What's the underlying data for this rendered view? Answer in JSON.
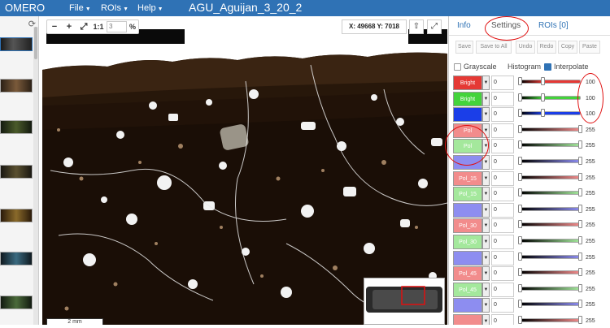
{
  "app": {
    "logo": "OMERO",
    "image_title": "AGU_Aguijan_3_20_2"
  },
  "menus": [
    {
      "label": "File"
    },
    {
      "label": "ROIs"
    },
    {
      "label": "Help"
    }
  ],
  "thumbnails": {
    "refresh_icon": "refresh-icon",
    "items": [
      "thumb-1",
      "thumb-2",
      "thumb-3",
      "thumb-4",
      "thumb-5",
      "thumb-6",
      "thumb-7"
    ]
  },
  "viewer": {
    "zoom_out": "−",
    "zoom_in": "+",
    "fit": "⤢",
    "one_to_one": "1:1",
    "zoom_value": "3",
    "zoom_unit": "%",
    "coords": "X: 49668 Y: 7018",
    "scale_bar": "2 mm",
    "upload_icon": "upload-icon",
    "fullscreen_icon": "fullscreen-icon"
  },
  "panel": {
    "tabs": [
      {
        "label": "Info"
      },
      {
        "label": "Settings"
      },
      {
        "label": "ROIs [0]"
      }
    ],
    "active_tab": "Settings",
    "buttons": {
      "save": "Save",
      "save_all": "Save to All",
      "undo": "Undo",
      "redo": "Redo",
      "copy": "Copy",
      "paste": "Paste"
    },
    "options": {
      "grayscale": "Grayscale",
      "histogram": "Histogram",
      "interpolate": "Interpolate"
    },
    "channels": [
      {
        "label": "Bright",
        "color": "#e53935",
        "start": "0",
        "end": "100",
        "fill": 0.38
      },
      {
        "label": "Bright",
        "color": "#43d33b",
        "start": "0",
        "end": "100",
        "fill": 0.38
      },
      {
        "label": "",
        "color": "#1b3ee8",
        "start": "0",
        "end": "100",
        "fill": 0.38
      },
      {
        "label": "Pol",
        "color": "#f28c8c",
        "start": "0",
        "end": "255",
        "fill": 1
      },
      {
        "label": "Pol",
        "color": "#a4e89c",
        "start": "0",
        "end": "255",
        "fill": 1
      },
      {
        "label": "",
        "color": "#8d8df0",
        "start": "0",
        "end": "255",
        "fill": 1
      },
      {
        "label": "Pol_15",
        "color": "#f28c8c",
        "start": "0",
        "end": "255",
        "fill": 1
      },
      {
        "label": "Pol_15",
        "color": "#a4e89c",
        "start": "0",
        "end": "255",
        "fill": 1
      },
      {
        "label": "",
        "color": "#8d8df0",
        "start": "0",
        "end": "255",
        "fill": 1
      },
      {
        "label": "Pol_30",
        "color": "#f28c8c",
        "start": "0",
        "end": "255",
        "fill": 1
      },
      {
        "label": "Pol_30",
        "color": "#a4e89c",
        "start": "0",
        "end": "255",
        "fill": 1
      },
      {
        "label": "",
        "color": "#8d8df0",
        "start": "0",
        "end": "255",
        "fill": 1
      },
      {
        "label": "Pol_45",
        "color": "#f28c8c",
        "start": "0",
        "end": "255",
        "fill": 1
      },
      {
        "label": "Pol_45",
        "color": "#a4e89c",
        "start": "0",
        "end": "255",
        "fill": 1
      },
      {
        "label": "",
        "color": "#8d8df0",
        "start": "0",
        "end": "255",
        "fill": 1
      },
      {
        "label": "",
        "color": "#f28c8c",
        "start": "0",
        "end": "255",
        "fill": 1
      }
    ]
  },
  "annotation_color": "#e01010"
}
